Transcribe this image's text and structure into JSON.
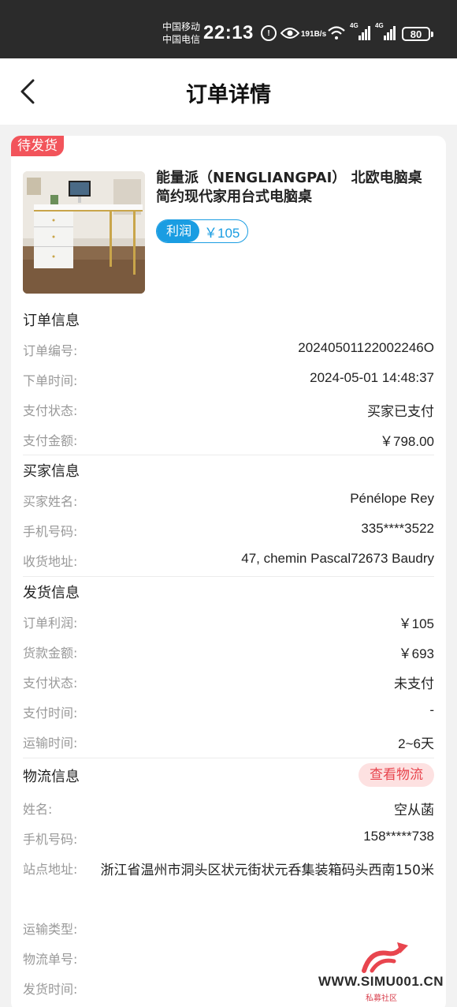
{
  "status_bar": {
    "carrier1": "中国移动",
    "carrier2": "中国电信",
    "time": "22:13",
    "net_speed_value": "191",
    "net_speed_unit": "B/s",
    "signal1_label": "4G",
    "signal2_label": "4G",
    "battery": "80"
  },
  "header": {
    "title": "订单详情"
  },
  "order": {
    "status_badge": "待发货",
    "product_title": "能量派（NENGLIANGPAI） 北欧电脑桌简约现代家用台式电脑桌",
    "profit_label": "利润",
    "profit_value": "￥105"
  },
  "order_info": {
    "title": "订单信息",
    "rows": [
      {
        "label": "订单编号:",
        "value": "20240501122002246O"
      },
      {
        "label": "下单时间:",
        "value": "2024-05-01 14:48:37"
      },
      {
        "label": "支付状态:",
        "value": "买家已支付"
      },
      {
        "label": "支付金额:",
        "value": "￥798.00"
      }
    ]
  },
  "buyer_info": {
    "title": "买家信息",
    "rows": [
      {
        "label": "买家姓名:",
        "value": "Pénélope Rey"
      },
      {
        "label": "手机号码:",
        "value": "335****3522"
      },
      {
        "label": "收货地址:",
        "value": "47, chemin Pascal72673 Baudry"
      }
    ]
  },
  "shipping_info": {
    "title": "发货信息",
    "rows": [
      {
        "label": "订单利润:",
        "value": "￥105"
      },
      {
        "label": "货款金额:",
        "value": "￥693"
      },
      {
        "label": "支付状态:",
        "value": "未支付"
      },
      {
        "label": "支付时间:",
        "value": "-"
      },
      {
        "label": "运输时间:",
        "value": "2~6天"
      }
    ]
  },
  "logistics_info": {
    "title": "物流信息",
    "track_button": "查看物流",
    "name_label": "姓名:",
    "name_value": "空从菡",
    "phone_label": "手机号码:",
    "phone_value": "158*****738",
    "address_label": "站点地址:",
    "address_value": "浙江省温州市洞头区状元街状元呑集装箱码头西南150米",
    "type_label": "运输类型:",
    "tracking_label": "物流单号:",
    "ship_time_label": "发货时间:"
  },
  "watermark": {
    "text": "WWW.SIMU001.CN",
    "sub": "私募社区"
  },
  "colors": {
    "accent_red": "#f2545b",
    "accent_blue": "#1a9de2",
    "status_bar": "#2b2b2b"
  }
}
